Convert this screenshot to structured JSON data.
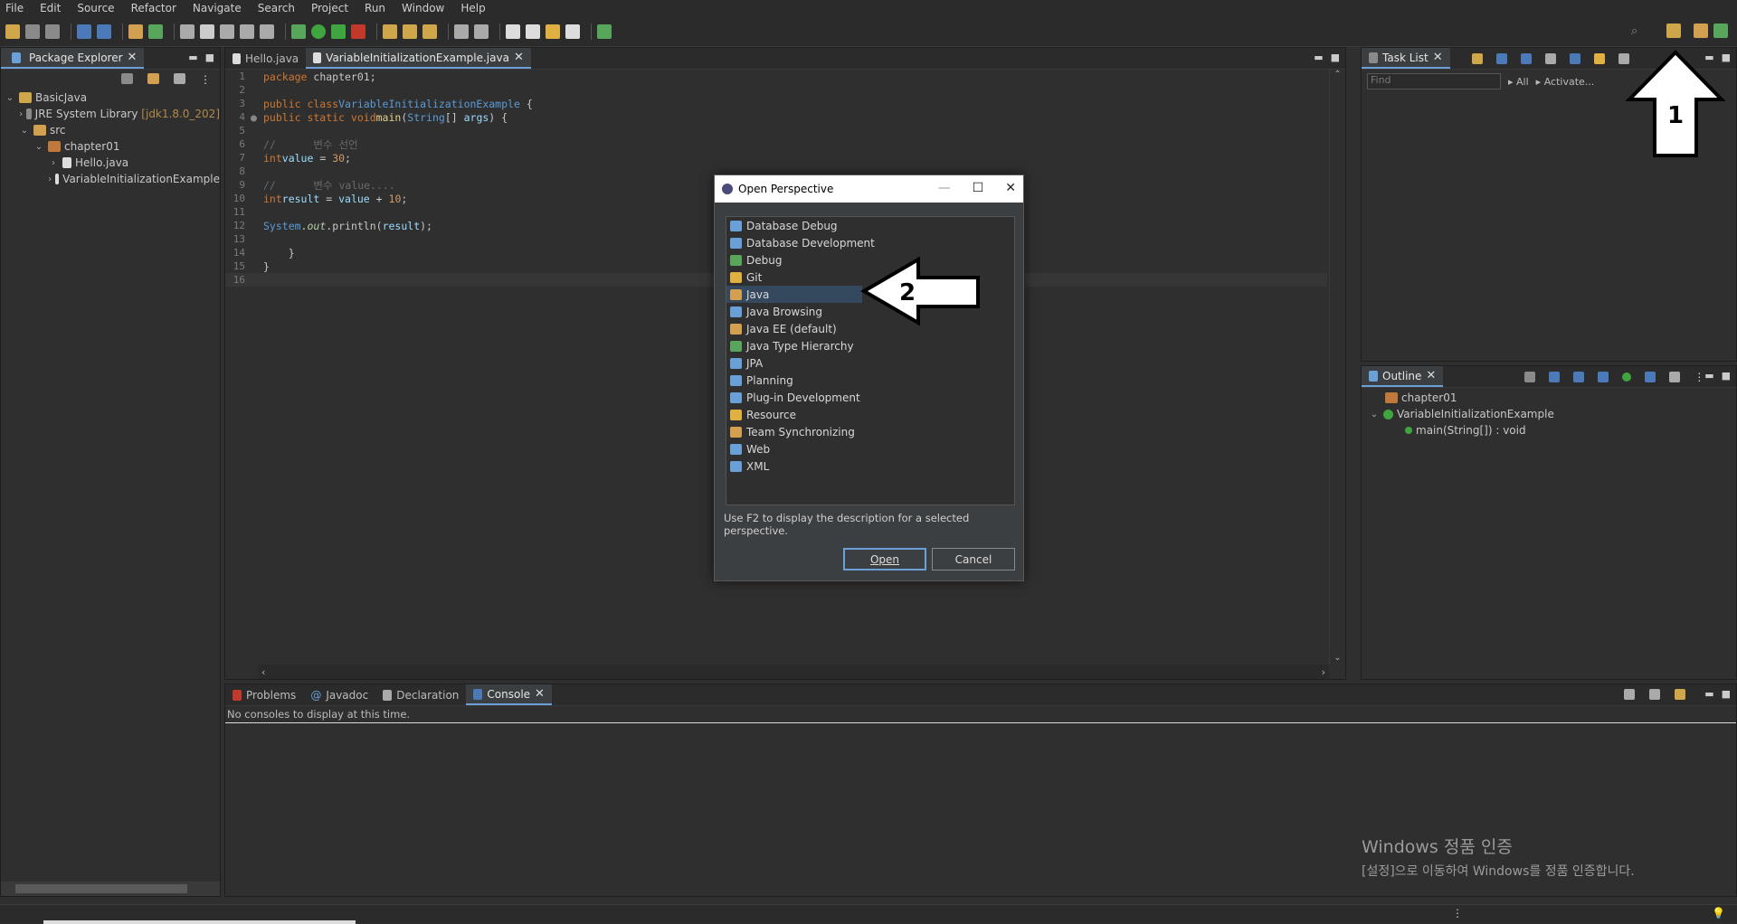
{
  "menu": [
    "File",
    "Edit",
    "Source",
    "Refactor",
    "Navigate",
    "Search",
    "Project",
    "Run",
    "Window",
    "Help"
  ],
  "package_explorer": {
    "tab": "Package Explorer",
    "tree": [
      {
        "label": "BasicJava",
        "depth": 0,
        "expanded": true
      },
      {
        "label": "JRE System Library",
        "suffix": "[jdk1.8.0_202]",
        "depth": 1,
        "expanded": false
      },
      {
        "label": "src",
        "depth": 1,
        "expanded": true
      },
      {
        "label": "chapter01",
        "depth": 2,
        "expanded": true
      },
      {
        "label": "Hello.java",
        "depth": 3,
        "expanded": false
      },
      {
        "label": "VariableInitializationExample",
        "depth": 3,
        "expanded": false
      }
    ]
  },
  "editor": {
    "tabs": [
      {
        "label": "Hello.java",
        "active": false
      },
      {
        "label": "VariableInitializationExample.java",
        "active": true
      }
    ],
    "lines": [
      "1",
      "2",
      "3",
      "4",
      "5",
      "6",
      "7",
      "8",
      "9",
      "10",
      "11",
      "12",
      "13",
      "14",
      "15",
      "16"
    ]
  },
  "task_list": {
    "tab": "Task List",
    "find_placeholder": "Find",
    "all": "All",
    "activate": "Activate..."
  },
  "outline": {
    "tab": "Outline",
    "items": [
      {
        "label": "chapter01",
        "depth": 0
      },
      {
        "label": "VariableInitializationExample",
        "depth": 0
      },
      {
        "label": "main(String[]) : void",
        "depth": 1
      }
    ]
  },
  "bottom": {
    "tabs": [
      {
        "label": "Problems",
        "active": false
      },
      {
        "label": "Javadoc",
        "active": false
      },
      {
        "label": "Declaration",
        "active": false
      },
      {
        "label": "Console",
        "active": true
      }
    ],
    "console_text": "No consoles to display at this time."
  },
  "dialog": {
    "title": "Open Perspective",
    "items": [
      {
        "label": "Database Debug",
        "color": "#6aa0d8"
      },
      {
        "label": "Database Development",
        "color": "#6aa0d8"
      },
      {
        "label": "Debug",
        "color": "#58a55c"
      },
      {
        "label": "Git",
        "color": "#e0b040"
      },
      {
        "label": "Java",
        "color": "#d2a050",
        "selected": true
      },
      {
        "label": "Java Browsing",
        "color": "#6aa0d8"
      },
      {
        "label": "Java EE (default)",
        "color": "#d2a050"
      },
      {
        "label": "Java Type Hierarchy",
        "color": "#58a55c"
      },
      {
        "label": "JPA",
        "color": "#6aa0d8"
      },
      {
        "label": "Planning",
        "color": "#6aa0d8"
      },
      {
        "label": "Plug-in Development",
        "color": "#6aa0d8"
      },
      {
        "label": "Resource",
        "color": "#e0b040"
      },
      {
        "label": "Team Synchronizing",
        "color": "#d2a050"
      },
      {
        "label": "Web",
        "color": "#6aa0d8"
      },
      {
        "label": "XML",
        "color": "#6aa0d8"
      }
    ],
    "hint": "Use F2 to display the description for a selected perspective.",
    "open": "Open",
    "cancel": "Cancel"
  },
  "annotations": {
    "arrow1": "1",
    "arrow2": "2"
  },
  "watermark": {
    "line1": "Windows 정품 인증",
    "line2": "[설정]으로 이동하여 Windows를 정품 인증합니다."
  }
}
